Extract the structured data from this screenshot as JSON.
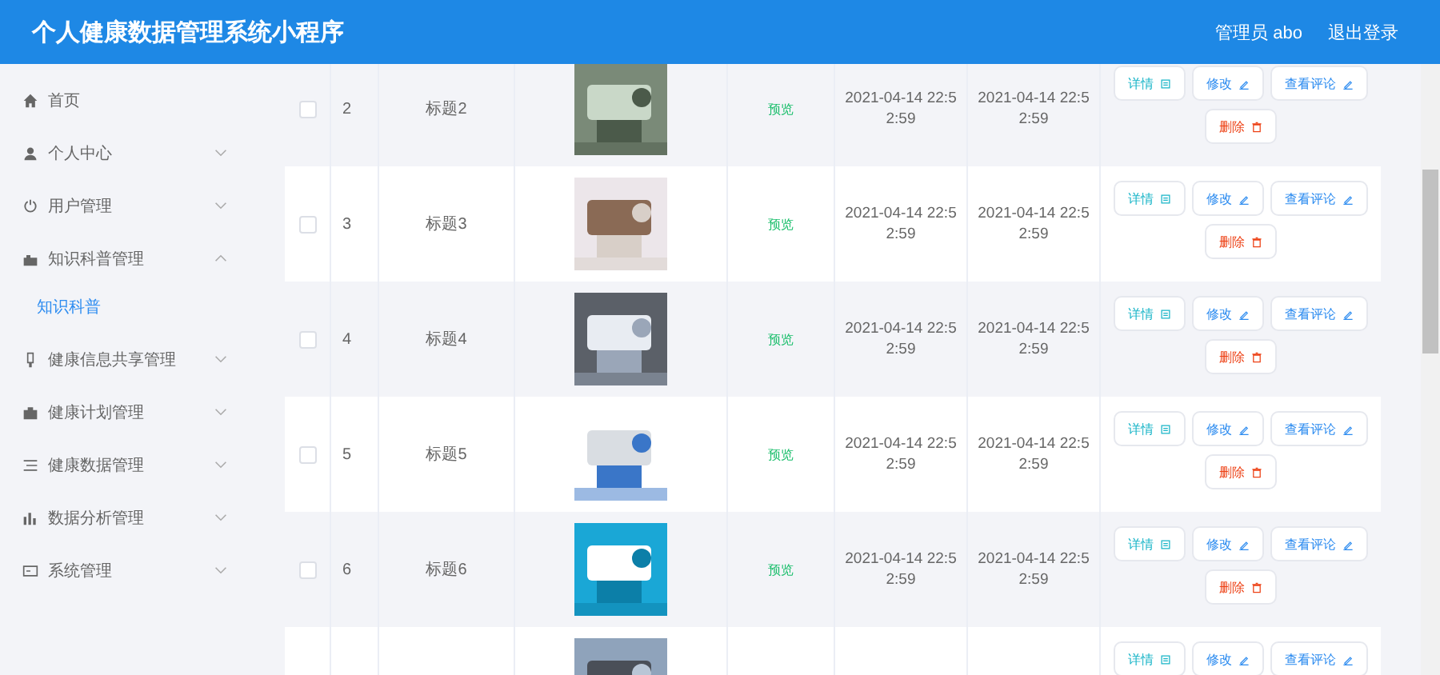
{
  "header": {
    "title": "个人健康数据管理系统小程序",
    "user": "管理员 abo",
    "logout": "退出登录"
  },
  "sidebar": {
    "items": [
      {
        "label": "首页"
      },
      {
        "label": "个人中心",
        "expanded": false
      },
      {
        "label": "用户管理",
        "expanded": false
      },
      {
        "label": "知识科普管理",
        "expanded": true,
        "children": [
          {
            "label": "知识科普",
            "selected": true
          }
        ]
      },
      {
        "label": "健康信息共享管理",
        "expanded": false
      },
      {
        "label": "健康计划管理",
        "expanded": false
      },
      {
        "label": "健康数据管理",
        "expanded": false
      },
      {
        "label": "数据分析管理",
        "expanded": false
      },
      {
        "label": "系统管理",
        "expanded": false
      }
    ]
  },
  "table": {
    "rows": [
      {
        "index": "2",
        "title": "标题2",
        "checked": false,
        "preview": "预览",
        "created": "2021-04-14 22:52:59",
        "updated": "2021-04-14 22:52:59",
        "actions": [
          {
            "label": "详情",
            "kind": "detail"
          },
          {
            "label": "修改",
            "kind": "edit"
          },
          {
            "label": "查看评论",
            "kind": "edit"
          },
          {
            "label": "删除",
            "kind": "delete"
          }
        ]
      },
      {
        "index": "3",
        "title": "标题3",
        "checked": false,
        "preview": "预览",
        "created": "2021-04-14 22:52:59",
        "updated": "2021-04-14 22:52:59",
        "actions": [
          {
            "label": "详情",
            "kind": "detail"
          },
          {
            "label": "修改",
            "kind": "edit"
          },
          {
            "label": "查看评论",
            "kind": "edit"
          },
          {
            "label": "删除",
            "kind": "delete"
          }
        ]
      },
      {
        "index": "4",
        "title": "标题4",
        "checked": false,
        "preview": "预览",
        "created": "2021-04-14 22:52:59",
        "updated": "2021-04-14 22:52:59",
        "actions": [
          {
            "label": "详情",
            "kind": "detail"
          },
          {
            "label": "修改",
            "kind": "edit"
          },
          {
            "label": "查看评论",
            "kind": "edit"
          },
          {
            "label": "删除",
            "kind": "delete"
          }
        ]
      },
      {
        "index": "5",
        "title": "标题5",
        "checked": false,
        "preview": "预览",
        "created": "2021-04-14 22:52:59",
        "updated": "2021-04-14 22:52:59",
        "actions": [
          {
            "label": "详情",
            "kind": "detail"
          },
          {
            "label": "修改",
            "kind": "edit"
          },
          {
            "label": "查看评论",
            "kind": "edit"
          },
          {
            "label": "删除",
            "kind": "delete"
          }
        ]
      },
      {
        "index": "6",
        "title": "标题6",
        "checked": false,
        "preview": "预览",
        "created": "2021-04-14 22:52:59",
        "updated": "2021-04-14 22:52:59",
        "actions": [
          {
            "label": "详情",
            "kind": "detail"
          },
          {
            "label": "修改",
            "kind": "edit"
          },
          {
            "label": "查看评论",
            "kind": "edit"
          },
          {
            "label": "删除",
            "kind": "delete"
          }
        ]
      },
      {
        "actions": [
          {
            "label": "详情",
            "kind": "detail"
          },
          {
            "label": "修改",
            "kind": "edit"
          },
          {
            "label": "查看评论",
            "kind": "edit"
          }
        ]
      }
    ]
  }
}
